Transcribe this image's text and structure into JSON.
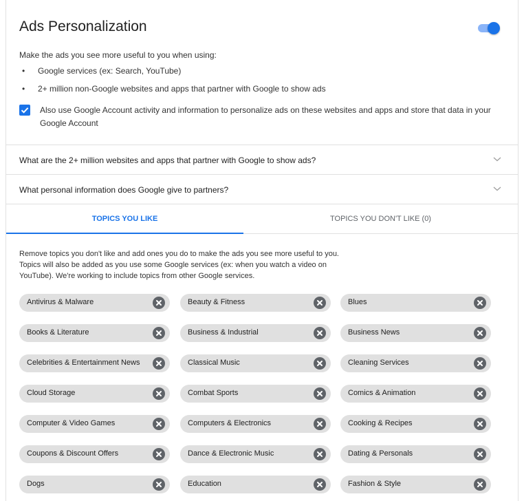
{
  "section": {
    "title": "Ads Personalization",
    "toggle_on": true,
    "intro": "Make the ads you see more useful to you when using:",
    "bullets": [
      "Google services (ex: Search, YouTube)",
      "2+ million non-Google websites and apps that partner with Google to show ads"
    ],
    "checkbox": {
      "checked": true,
      "label": "Also use Google Account activity and information to personalize ads on these websites and apps and store that data in your Google Account"
    }
  },
  "faqs": [
    "What are the 2+ million websites and apps that partner with Google to show ads?",
    "What personal information does Google give to partners?"
  ],
  "tabs": {
    "like": "TOPICS YOU LIKE",
    "dislike": "TOPICS YOU DON'T LIKE (0)"
  },
  "description": "Remove topics you don't like and add ones you do to make the ads you see more useful to you. Topics will also be added as you use some Google services (ex: when you watch a video on YouTube). We're working to include topics from other Google services.",
  "topics": [
    [
      "Antivirus & Malware",
      "Beauty & Fitness",
      "Blues"
    ],
    [
      "Books & Literature",
      "Business & Industrial",
      "Business News"
    ],
    [
      "Celebrities & Entertainment News",
      "Classical Music",
      "Cleaning Services"
    ],
    [
      "Cloud Storage",
      "Combat Sports",
      "Comics & Animation"
    ],
    [
      "Computer & Video Games",
      "Computers & Electronics",
      "Cooking & Recipes"
    ],
    [
      "Coupons & Discount Offers",
      "Dance & Electronic Music",
      "Dating & Personals"
    ],
    [
      "Dogs",
      "Education",
      "Fashion & Style"
    ]
  ],
  "colors": {
    "accent": "#1a73e8",
    "chip_bg": "#e0e0e0",
    "chip_close": "#5f6368"
  },
  "icons": {
    "toggle": "toggle-switch-icon",
    "check": "checkmark-icon",
    "chevron": "chevron-down-icon",
    "remove": "close-circle-icon"
  }
}
